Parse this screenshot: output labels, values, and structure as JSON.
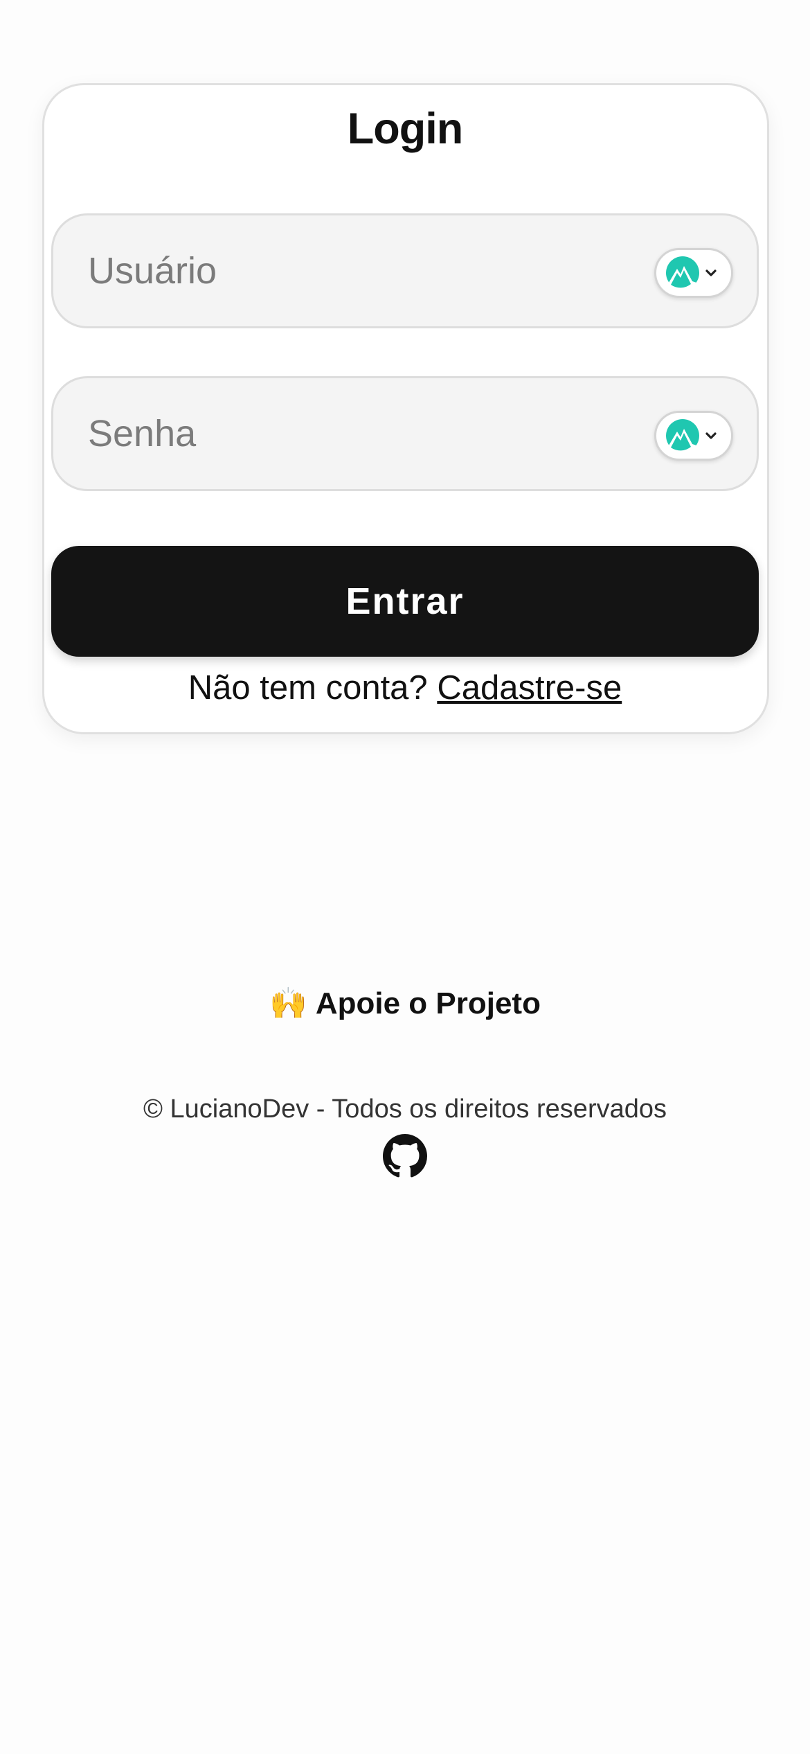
{
  "login": {
    "title": "Login",
    "username_placeholder": "Usuário",
    "password_placeholder": "Senha",
    "submit_label": "Entrar",
    "signup_prompt": "Não tem conta?",
    "signup_link": "Cadastre-se"
  },
  "password_manager_widget": {
    "icon": "nordpass-icon",
    "accent_color": "#1fc7b0"
  },
  "footer": {
    "support_emoji": "🙌",
    "support_label": "Apoie o Projeto",
    "copyright": "© LucianoDev - Todos os direitos reservados",
    "github_icon": "github-icon"
  },
  "colors": {
    "button_bg": "#141414",
    "field_bg": "#f4f4f4",
    "card_border": "#e0e0e0"
  }
}
